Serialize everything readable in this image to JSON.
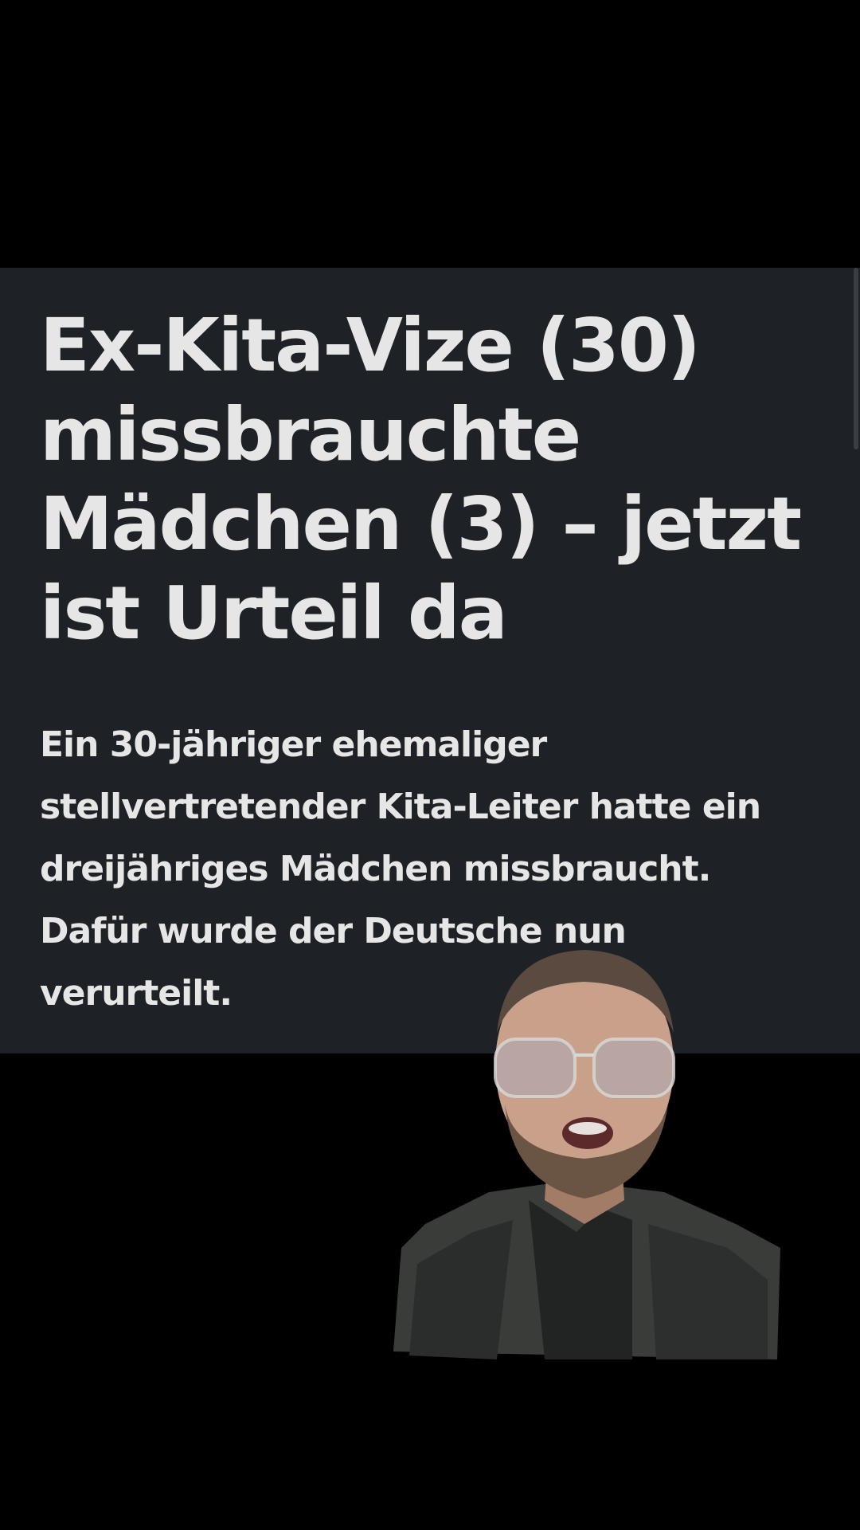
{
  "article": {
    "headline": "Ex-Kita-Vize (30) missbrauchte Mädchen (3) – jetzt ist Urteil da",
    "teaser": "Ein 30-jähriger ehemaliger stellvertretender Kita-Leiter hatte ein dreijähriges Mädchen missbraucht. Dafür wurde der Deutsche nun verurteilt."
  },
  "colors": {
    "background": "#000000",
    "card": "#1e2125",
    "text": "#e6e6e6"
  },
  "overlay": {
    "presenter": "person-cutout"
  }
}
